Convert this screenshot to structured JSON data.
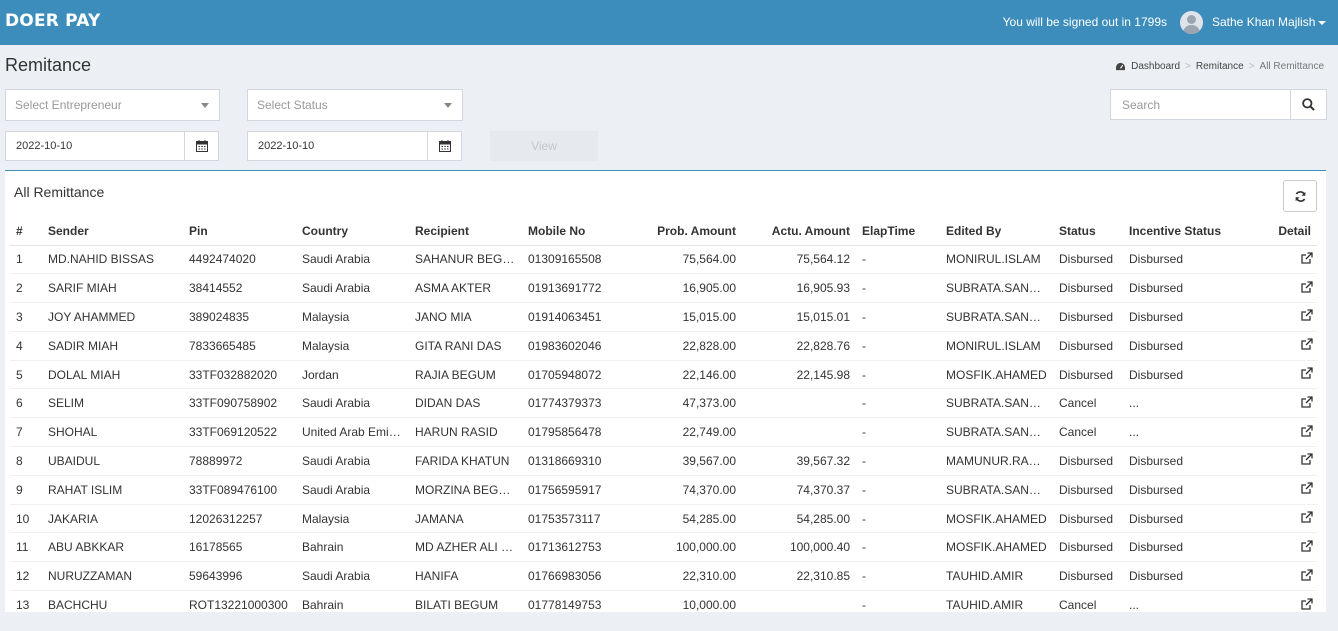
{
  "header": {
    "brand": "DOER PAY",
    "signout_notice": "You will be signed out in 1799s",
    "username": "Sathe Khan Majlish"
  },
  "page": {
    "title": "Remitance",
    "breadcrumb": [
      "Dashboard",
      "Remitance",
      "All Remittance"
    ]
  },
  "filters": {
    "entrepreneur_placeholder": "Select Entrepreneur",
    "status_placeholder": "Select Status",
    "from_date": "2022-10-10",
    "to_date": "2022-10-10",
    "view_label": "View",
    "search_placeholder": "Search"
  },
  "table": {
    "title": "All Remittance",
    "columns": [
      "#",
      "Sender",
      "Pin",
      "Country",
      "Recipient",
      "Mobile No",
      "Prob. Amount",
      "Actu. Amount",
      "ElapTime",
      "Edited By",
      "Status",
      "Incentive Status",
      "Detail"
    ],
    "rows": [
      [
        "1",
        "MD.NAHID BISSAS",
        "4492474020",
        "Saudi Arabia",
        "SAHANUR BEGUM",
        "01309165508",
        "75,564.00",
        "75,564.12",
        "-",
        "MONIRUL.ISLAM",
        "Disbursed",
        "Disbursed"
      ],
      [
        "2",
        "SARIF MIAH",
        "38414552",
        "Saudi Arabia",
        "ASMA AKTER",
        "01913691772",
        "16,905.00",
        "16,905.93",
        "-",
        "SUBRATA.SANYAL",
        "Disbursed",
        "Disbursed"
      ],
      [
        "3",
        "JOY AHAMMED",
        "389024835",
        "Malaysia",
        "JANO MIA",
        "01914063451",
        "15,015.00",
        "15,015.01",
        "-",
        "SUBRATA.SANYAL",
        "Disbursed",
        "Disbursed"
      ],
      [
        "4",
        "SADIR MIAH",
        "7833665485",
        "Malaysia",
        "GITA RANI DAS",
        "01983602046",
        "22,828.00",
        "22,828.76",
        "-",
        "MONIRUL.ISLAM",
        "Disbursed",
        "Disbursed"
      ],
      [
        "5",
        "DOLAL MIAH",
        "33TF032882020",
        "Jordan",
        "RAJIA BEGUM",
        "01705948072",
        "22,146.00",
        "22,145.98",
        "-",
        "MOSFIK.AHAMED",
        "Disbursed",
        "Disbursed"
      ],
      [
        "6",
        "SELIM",
        "33TF090758902",
        "Saudi Arabia",
        "DIDAN DAS",
        "01774379373",
        "47,373.00",
        "",
        "-",
        "SUBRATA.SANYAL",
        "Cancel",
        "..."
      ],
      [
        "7",
        "SHOHAL",
        "33TF069120522",
        "United Arab Emirates",
        "HARUN RASID",
        "01795856478",
        "22,749.00",
        "",
        "-",
        "SUBRATA.SANYAL",
        "Cancel",
        "..."
      ],
      [
        "8",
        "UBAIDUL",
        "78889972",
        "Saudi Arabia",
        "FARIDA KHATUN",
        "01318669310",
        "39,567.00",
        "39,567.32",
        "-",
        "MAMUNUR.RASHID",
        "Disbursed",
        "Disbursed"
      ],
      [
        "9",
        "RAHAT ISLIM",
        "33TF089476100",
        "Saudi Arabia",
        "MORZINA BEGUM",
        "01756595917",
        "74,370.00",
        "74,370.37",
        "-",
        "SUBRATA.SANYAL",
        "Disbursed",
        "Disbursed"
      ],
      [
        "10",
        "JAKARIA",
        "12026312257",
        "Malaysia",
        "JAMANA",
        "01753573117",
        "54,285.00",
        "54,285.00",
        "-",
        "MOSFIK.AHAMED",
        "Disbursed",
        "Disbursed"
      ],
      [
        "11",
        "ABU ABKKAR",
        "16178565",
        "Bahrain",
        "MD AZHER ALI BEPARI",
        "01713612753",
        "100,000.00",
        "100,000.40",
        "-",
        "MOSFIK.AHAMED",
        "Disbursed",
        "Disbursed"
      ],
      [
        "12",
        "NURUZZAMAN",
        "59643996",
        "Saudi Arabia",
        "HANIFA",
        "01766983056",
        "22,310.00",
        "22,310.85",
        "-",
        "TAUHID.AMIR",
        "Disbursed",
        "Disbursed"
      ],
      [
        "13",
        "BACHCHU",
        "ROT13221000300",
        "Bahrain",
        "BILATI BEGUM",
        "01778149753",
        "10,000.00",
        "",
        "-",
        "TAUHID.AMIR",
        "Cancel",
        "..."
      ]
    ]
  },
  "icons": {
    "calendar": "calendar-icon",
    "search": "search-icon",
    "refresh": "refresh-icon",
    "detail": "external-link-icon",
    "dashboard": "dashboard-icon"
  },
  "colors": {
    "header_bg": "#3c8dbc",
    "page_bg": "#ecf0f5"
  }
}
